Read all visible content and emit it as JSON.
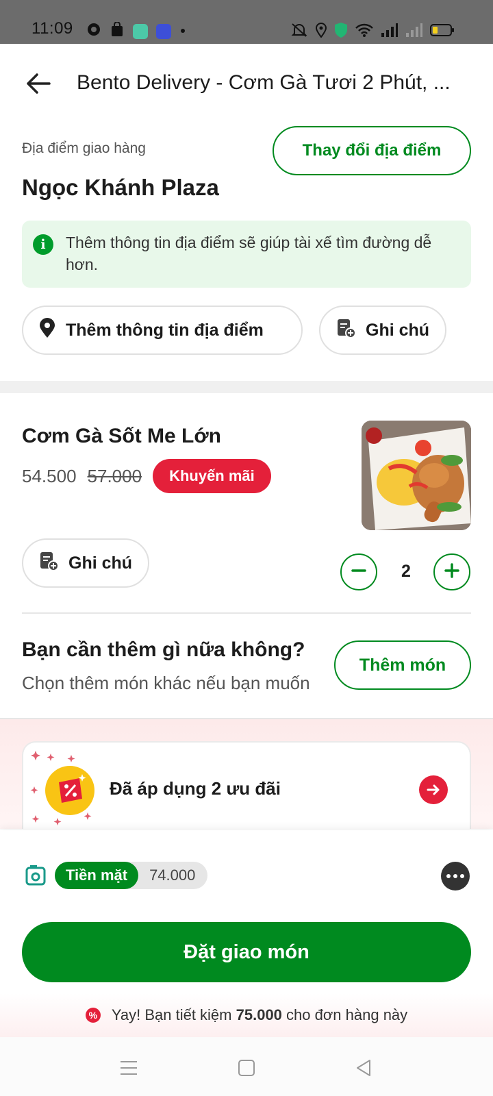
{
  "status_bar": {
    "time": "11:09"
  },
  "header": {
    "title": "Bento Delivery - Cơm Gà Tươi 2 Phút, ..."
  },
  "delivery": {
    "label": "Địa điểm giao hàng",
    "place": "Ngọc Khánh Plaza",
    "change_button": "Thay đổi địa điểm",
    "info_text": "Thêm thông tin địa điểm sẽ giúp tài xế tìm đường dễ hơn.",
    "add_info_button": "Thêm thông tin địa điểm",
    "note_button": "Ghi chú"
  },
  "item": {
    "name": "Cơm Gà Sốt Me Lớn",
    "price": "54.500",
    "original_price": "57.000",
    "promo_badge": "Khuyến mãi",
    "note_button": "Ghi chú",
    "quantity": "2"
  },
  "add_more": {
    "title": "Bạn cần thêm gì nữa không?",
    "subtitle": "Chọn thêm món khác nếu bạn muốn",
    "button": "Thêm món"
  },
  "promotions": {
    "text": "Đã áp dụng 2 ưu đãi"
  },
  "payment": {
    "method": "Tiền mặt",
    "amount": "74.000"
  },
  "order_button": "Đặt giao món",
  "savings": {
    "prefix": "Yay! Bạn tiết kiệm",
    "amount": "75.000",
    "suffix": "cho đơn hàng này"
  },
  "colors": {
    "primary_green": "#008a1f",
    "promo_red": "#e4203a",
    "info_bg": "#e8f8ea"
  }
}
